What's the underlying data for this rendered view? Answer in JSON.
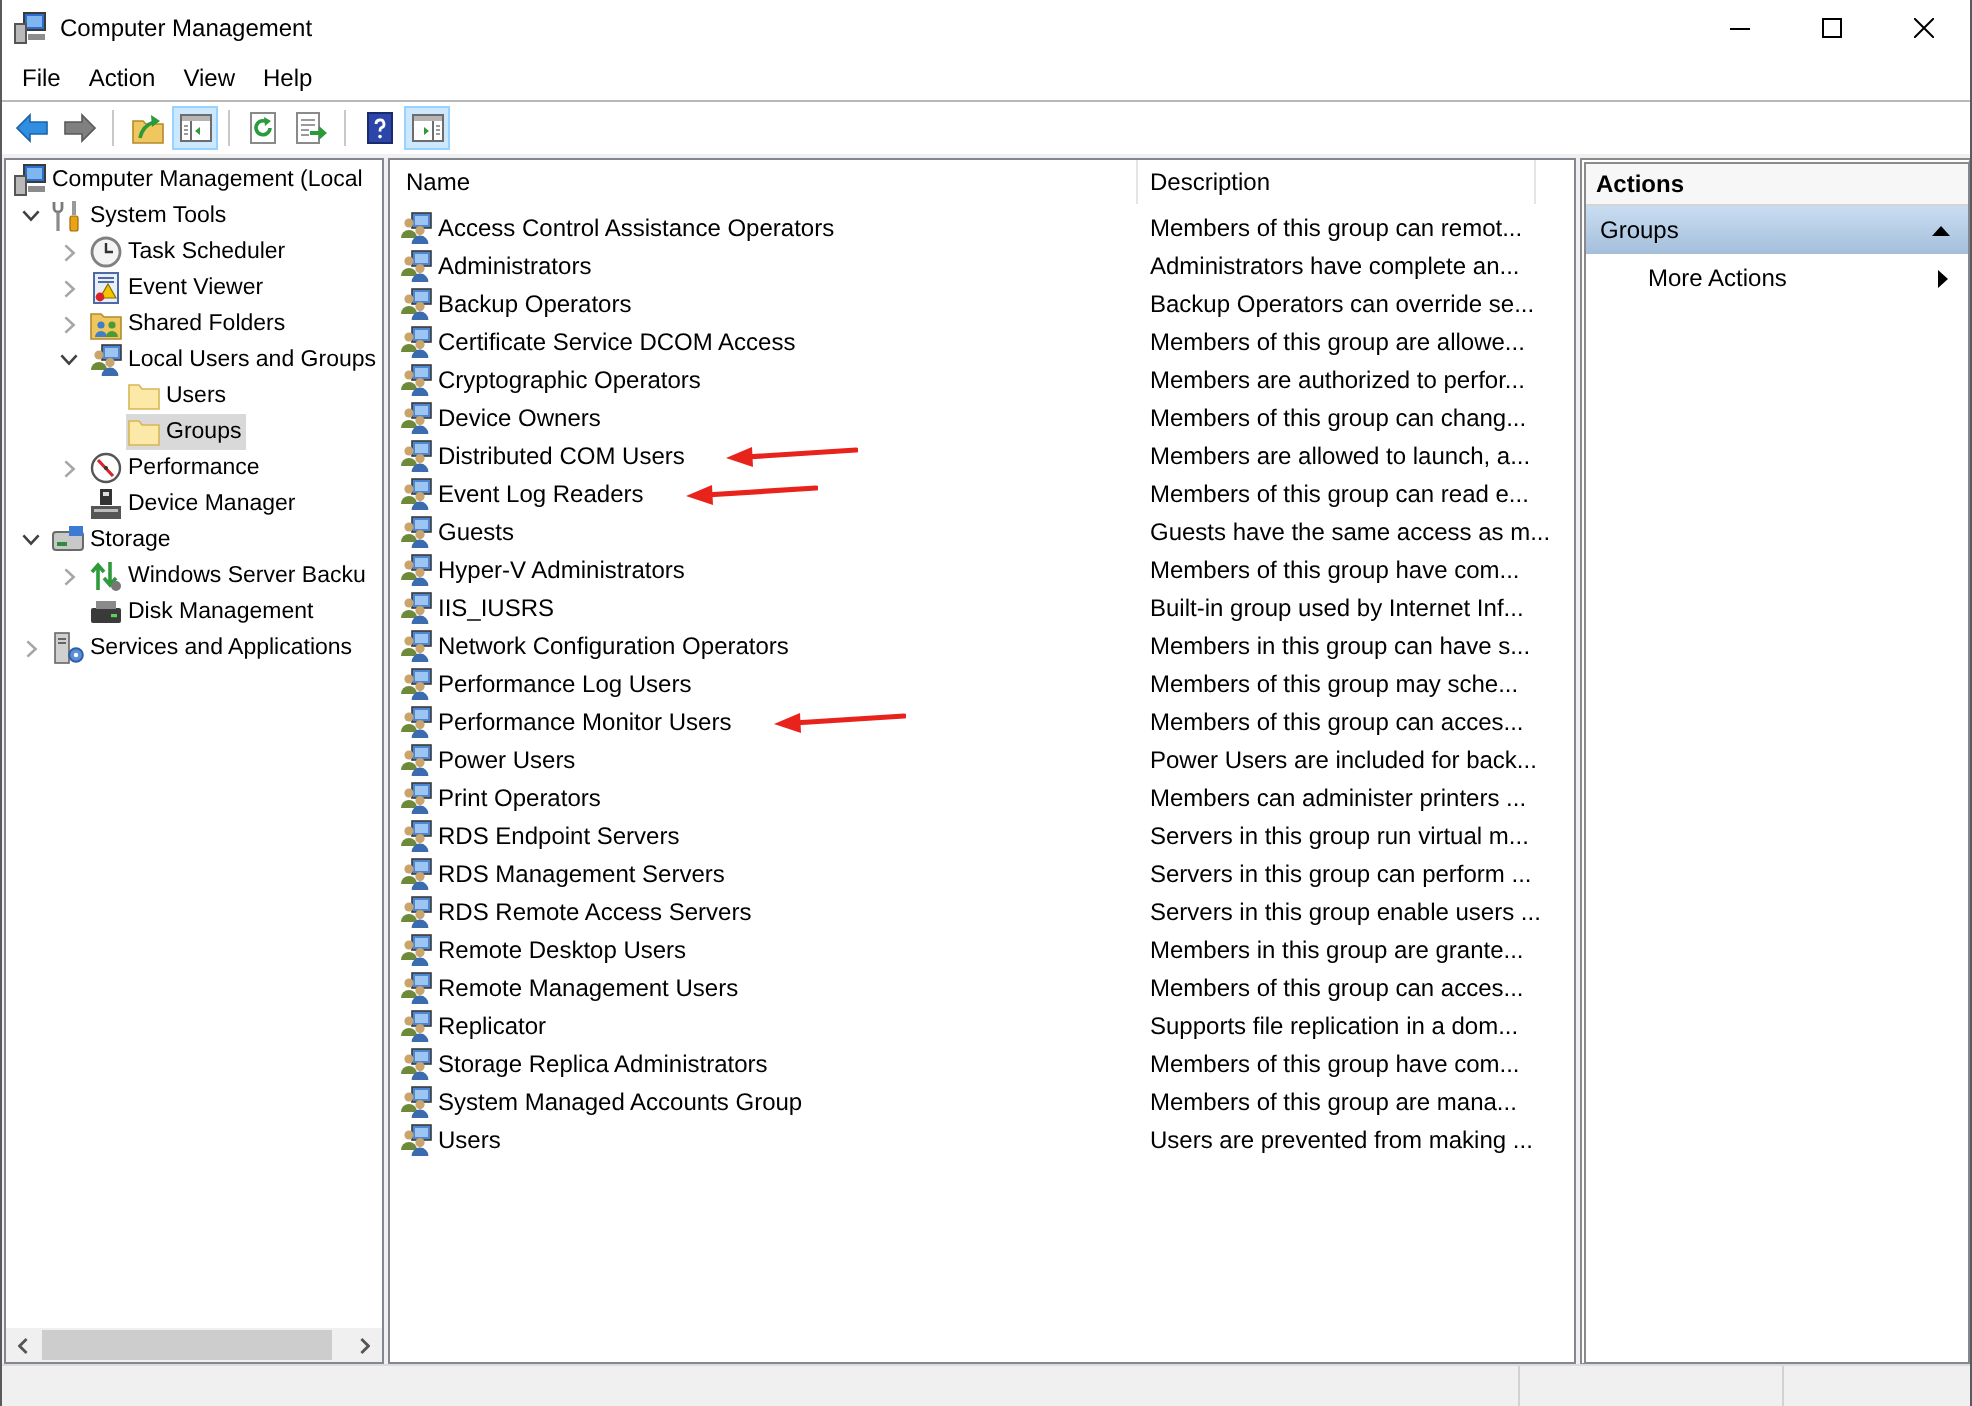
{
  "window": {
    "title": "Computer Management"
  },
  "menu": [
    {
      "label": "File"
    },
    {
      "label": "Action"
    },
    {
      "label": "View"
    },
    {
      "label": "Help"
    }
  ],
  "toolbar": [
    {
      "buttons": [
        {
          "kind": "back",
          "pressed": false,
          "disabled": false
        },
        {
          "kind": "forward",
          "pressed": false,
          "disabled": true
        }
      ]
    },
    {
      "buttons": [
        {
          "kind": "up",
          "pressed": false,
          "disabled": false
        },
        {
          "kind": "tree_pane",
          "pressed": true,
          "disabled": false
        }
      ]
    },
    {
      "buttons": [
        {
          "kind": "refresh",
          "pressed": false,
          "disabled": false
        },
        {
          "kind": "export",
          "pressed": false,
          "disabled": false
        }
      ]
    },
    {
      "buttons": [
        {
          "kind": "help",
          "pressed": false,
          "disabled": false
        },
        {
          "kind": "action_pane",
          "pressed": true,
          "disabled": false
        }
      ]
    }
  ],
  "tree": [
    {
      "label": "Computer Management (Local",
      "kind": "computer",
      "selected": false,
      "children": [
        {
          "label": "System Tools",
          "kind": "tools",
          "expanded": true,
          "selected": false,
          "children": [
            {
              "label": "Task Scheduler",
              "kind": "clock",
              "expanded": false,
              "selected": false
            },
            {
              "label": "Event Viewer",
              "kind": "log",
              "expanded": false,
              "selected": false
            },
            {
              "label": "Shared Folders",
              "kind": "shared",
              "expanded": false,
              "selected": false
            },
            {
              "label": "Local Users and Groups",
              "kind": "users",
              "expanded": true,
              "selected": false,
              "children": [
                {
                  "label": "Users",
                  "kind": "folder",
                  "selected": false
                },
                {
                  "label": "Groups",
                  "kind": "folder",
                  "selected": true
                }
              ]
            },
            {
              "label": "Performance",
              "kind": "gauge",
              "expanded": false,
              "selected": false
            },
            {
              "label": "Device Manager",
              "kind": "device",
              "selected": false
            }
          ]
        },
        {
          "label": "Storage",
          "kind": "storage",
          "expanded": true,
          "selected": false,
          "children": [
            {
              "label": "Windows Server Backu",
              "kind": "backup",
              "expanded": false,
              "selected": false
            },
            {
              "label": "Disk Management",
              "kind": "disk",
              "selected": false
            }
          ]
        },
        {
          "label": "Services and Applications",
          "kind": "services",
          "expanded": false,
          "selected": false
        }
      ]
    }
  ],
  "table": {
    "columns": [
      "Name",
      "Description"
    ],
    "rows": [
      {
        "name": "Access Control Assistance Operators",
        "description": "Members of this group can remot...",
        "annotated": false
      },
      {
        "name": "Administrators",
        "description": "Administrators have complete an...",
        "annotated": false
      },
      {
        "name": "Backup Operators",
        "description": "Backup Operators can override se...",
        "annotated": false
      },
      {
        "name": "Certificate Service DCOM Access",
        "description": "Members of this group are allowe...",
        "annotated": false
      },
      {
        "name": "Cryptographic Operators",
        "description": "Members are authorized to perfor...",
        "annotated": false
      },
      {
        "name": "Device Owners",
        "description": "Members of this group can chang...",
        "annotated": false
      },
      {
        "name": "Distributed COM Users",
        "description": "Members are allowed to launch, a...",
        "annotated": true
      },
      {
        "name": "Event Log Readers",
        "description": "Members of this group can read e...",
        "annotated": true
      },
      {
        "name": "Guests",
        "description": "Guests have the same access as m...",
        "annotated": false
      },
      {
        "name": "Hyper-V Administrators",
        "description": "Members of this group have com...",
        "annotated": false
      },
      {
        "name": "IIS_IUSRS",
        "description": "Built-in group used by Internet Inf...",
        "annotated": false
      },
      {
        "name": "Network Configuration Operators",
        "description": "Members in this group can have s...",
        "annotated": false
      },
      {
        "name": "Performance Log Users",
        "description": "Members of this group may sche...",
        "annotated": false
      },
      {
        "name": "Performance Monitor Users",
        "description": "Members of this group can acces...",
        "annotated": true
      },
      {
        "name": "Power Users",
        "description": "Power Users are included for back...",
        "annotated": false
      },
      {
        "name": "Print Operators",
        "description": "Members can administer printers ...",
        "annotated": false
      },
      {
        "name": "RDS Endpoint Servers",
        "description": "Servers in this group run virtual m...",
        "annotated": false
      },
      {
        "name": "RDS Management Servers",
        "description": "Servers in this group can perform ...",
        "annotated": false
      },
      {
        "name": "RDS Remote Access Servers",
        "description": "Servers in this group enable users ...",
        "annotated": false
      },
      {
        "name": "Remote Desktop Users",
        "description": "Members in this group are grante...",
        "annotated": false
      },
      {
        "name": "Remote Management Users",
        "description": "Members of this group can acces...",
        "annotated": false
      },
      {
        "name": "Replicator",
        "description": "Supports file replication in a dom...",
        "annotated": false
      },
      {
        "name": "Storage Replica Administrators",
        "description": "Members of this group have com...",
        "annotated": false
      },
      {
        "name": "System Managed Accounts Group",
        "description": "Members of this group are mana...",
        "annotated": false
      },
      {
        "name": "Users",
        "description": "Users are prevented from making ...",
        "annotated": false
      }
    ]
  },
  "actions": {
    "title": "Actions",
    "sections": [
      {
        "title": "Groups",
        "expanded": true,
        "items": [
          {
            "label": "More Actions",
            "submenu": true
          }
        ]
      }
    ]
  }
}
